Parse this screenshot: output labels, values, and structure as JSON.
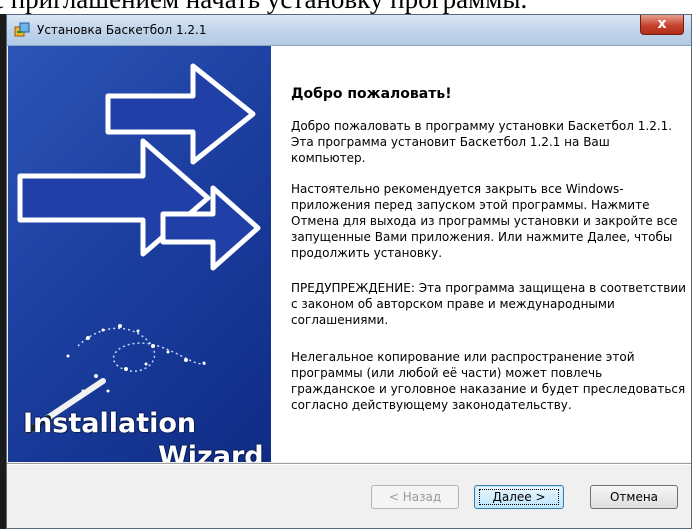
{
  "document": {
    "caption": "с приглашением начать установку программы."
  },
  "window": {
    "title": "Установка Баскетбол 1.2.1",
    "close_symbol": "x"
  },
  "banner": {
    "line1": "Installation",
    "line2": "Wizard",
    "icons": [
      "arrow-icon",
      "arrow-icon",
      "arrow-icon",
      "magic-wand-icon",
      "sparkles-icon"
    ]
  },
  "content": {
    "heading": "Добро пожаловать!",
    "paragraphs": [
      "Добро пожаловать в программу установки Баскетбол 1.2.1. Эта программа установит Баскетбол 1.2.1 на Ваш компьютер.",
      "Настоятельно рекомендуется закрыть все Windows-приложения перед запуском этой программы. Нажмите Отмена для выхода из программы установки и закройте все запущенные Вами приложения. Или нажмите Далее, чтобы продолжить установку.",
      "ПРЕДУПРЕЖДЕНИЕ: Эта программа защищена в соответствии с законом об авторском праве и международными соглашениями.",
      "Нелегальное копирование или распространение этой программы (или любой её части) может повлечь гражданское и уголовное наказание и будет преследоваться согласно действующему законодательству."
    ]
  },
  "buttons": {
    "back": "< Назад",
    "next": "Далее >",
    "cancel": "Отмена"
  },
  "colors": {
    "banner": "#1c3fa0",
    "close_button": "#c7432f",
    "default_button_border": "#3c7fb1"
  }
}
